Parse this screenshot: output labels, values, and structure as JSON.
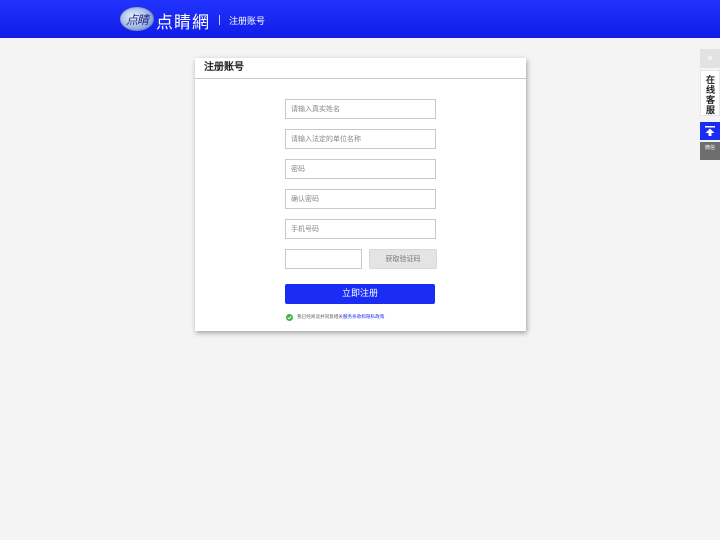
{
  "header": {
    "logo_emblem_text": "点睛",
    "logo_text": "点睛網",
    "page_title": "注册账号"
  },
  "form": {
    "title": "注册账号",
    "fields": {
      "real_name_placeholder": "请输入真实姓名",
      "company_placeholder": "请输入法定的单位名称",
      "password_placeholder": "密码",
      "confirm_password_placeholder": "确认密码",
      "phone_placeholder": "手机号码",
      "verification_code_value": ""
    },
    "get_code_label": "获取验证码",
    "submit_label": "立即注册",
    "agreement": {
      "prefix": "我已经阅读并同意相关",
      "link": "服务条款和隐私政策"
    }
  },
  "side_toolbar": {
    "collapse_label": "»",
    "service_label": "在线客服",
    "qr_label": "微信"
  },
  "colors": {
    "brand_blue": "#1b2cf5",
    "header_gradient_top": "#2233ff",
    "check_green": "#3bb54a"
  },
  "icons": {
    "check": "check-circle-icon",
    "back_to_top": "arrow-up-icon"
  }
}
